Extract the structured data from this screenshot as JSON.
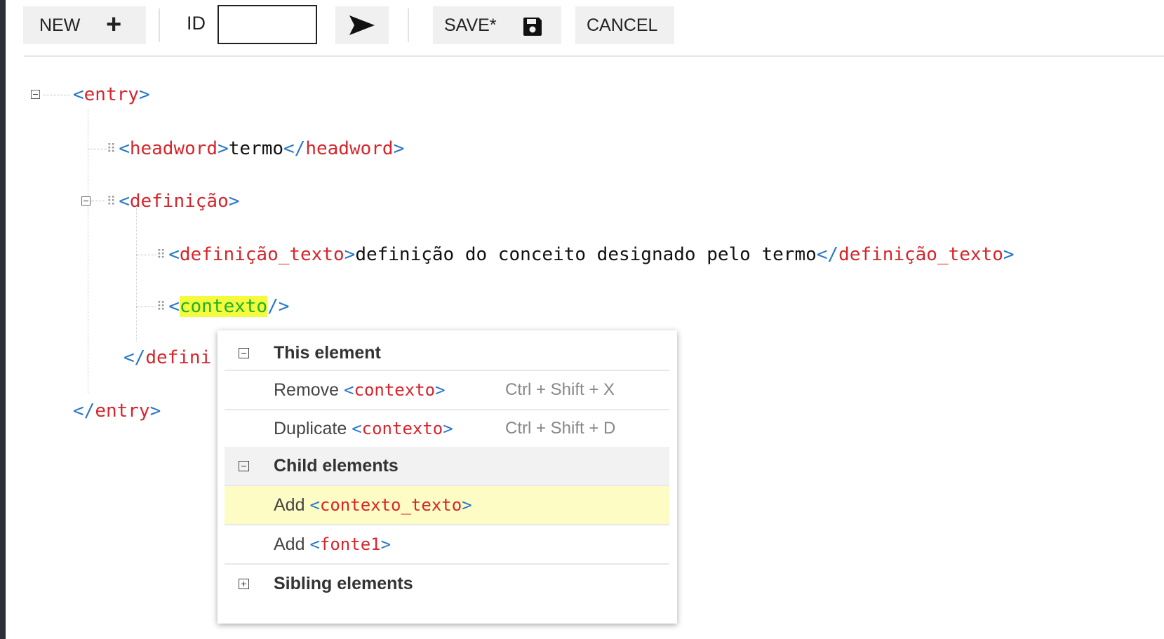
{
  "toolbar": {
    "new_label": "NEW",
    "new_icon": "+",
    "id_label": "ID",
    "id_value": "",
    "save_label": "SAVE*",
    "cancel_label": "CANCEL"
  },
  "tree": {
    "entry_tag": "entry",
    "headword_tag": "headword",
    "headword_text": "termo",
    "definicao_tag": "definição",
    "definicao_texto_tag": "definição_texto",
    "definicao_texto_text": "definição do conceito designado pelo termo",
    "contexto_tag": "contexto",
    "definicao_close_partial": "defini"
  },
  "context_menu": {
    "this_element_header": "This element",
    "remove_label": "Remove",
    "remove_tag": "contexto",
    "remove_shortcut": "Ctrl + Shift + X",
    "duplicate_label": "Duplicate",
    "duplicate_tag": "contexto",
    "duplicate_shortcut": "Ctrl + Shift + D",
    "child_elements_header": "Child elements",
    "add_label_1": "Add",
    "add_tag_1": "contexto_texto",
    "add_label_2": "Add",
    "add_tag_2": "fonte1",
    "sibling_elements_header": "Sibling elements"
  },
  "colors": {
    "tag": "#d6252c",
    "bracket": "#2a78c8",
    "highlight": "#f3fb3c",
    "menu_hover": "#fdfcc4"
  }
}
